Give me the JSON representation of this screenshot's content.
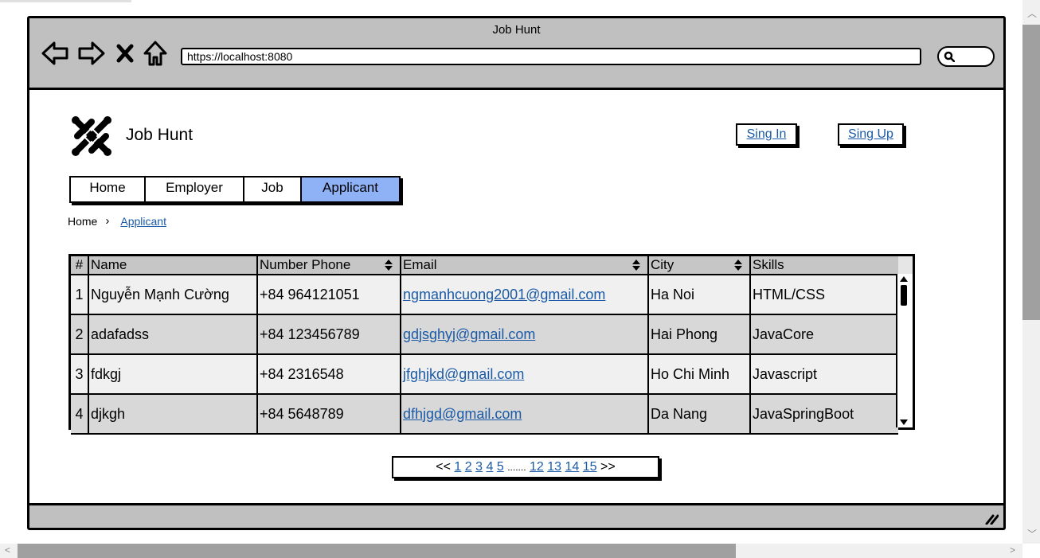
{
  "window": {
    "title": "Job Hunt",
    "url": "https://localhost:8080"
  },
  "site": {
    "brand": "Job Hunt",
    "sign_in": "Sing In",
    "sign_up": "Sing Up"
  },
  "menu": [
    {
      "label": "Home",
      "active": false
    },
    {
      "label": "Employer",
      "active": false
    },
    {
      "label": "Job",
      "active": false
    },
    {
      "label": "Applicant",
      "active": true
    }
  ],
  "breadcrumb": {
    "home": "Home",
    "separator": "›",
    "current": "Applicant"
  },
  "table": {
    "headers": [
      "#",
      "Name",
      "Number Phone",
      "Email",
      "City",
      "Skills"
    ],
    "rows": [
      {
        "num": "1",
        "name": "Nguyễn Mạnh Cường",
        "phone": "+84 964121051",
        "email": "ngmanhcuong2001@gmail.com",
        "city": "Ha Noi",
        "skills": "HTML/CSS"
      },
      {
        "num": "2",
        "name": "adafadss",
        "phone": "+84 123456789",
        "email": "gdjsghyj@gmail.com",
        "city": "Hai Phong",
        "skills": "JavaCore"
      },
      {
        "num": "3",
        "name": "fdkgj",
        "phone": "+84 2316548",
        "email": "jfghjkd@gmail.com",
        "city": "Ho Chi Minh",
        "skills": "Javascript"
      },
      {
        "num": "4",
        "name": "djkgh",
        "phone": "+84 5648789",
        "email": "dfhjgd@gmail.com",
        "city": "Da Nang",
        "skills": "JavaSpringBoot"
      }
    ]
  },
  "pagination": {
    "prev": "<<",
    "pages_start": [
      "1",
      "2",
      "3",
      "4",
      "5"
    ],
    "ellipsis": ".......",
    "pages_end": [
      "12",
      "13",
      "14",
      "15"
    ],
    "next": ">>"
  },
  "colors": {
    "active_tab": "#8fb2f6",
    "link": "#1a5aa6",
    "chrome": "#c0c0c0"
  }
}
